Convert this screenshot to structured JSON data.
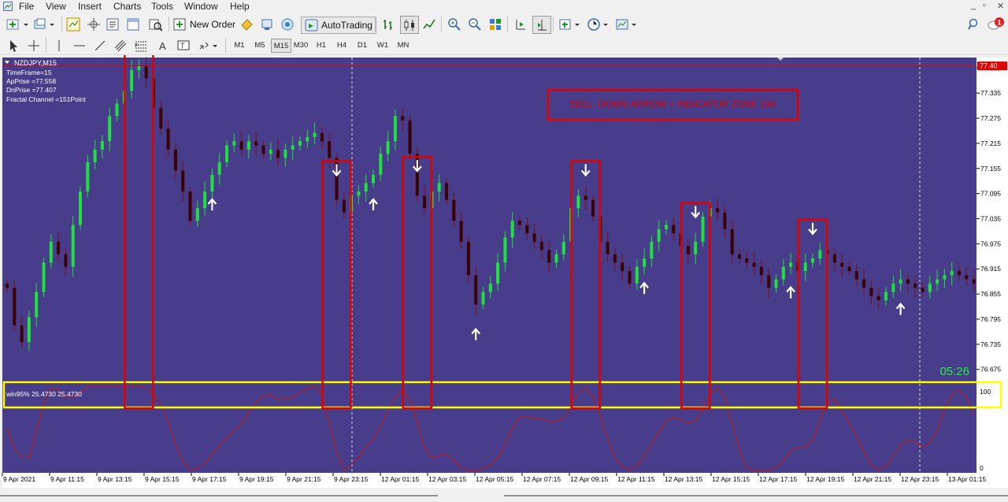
{
  "menu": {
    "items": [
      "File",
      "View",
      "Insert",
      "Charts",
      "Tools",
      "Window",
      "Help"
    ],
    "window_controls": [
      "_",
      "▫",
      "✕"
    ]
  },
  "toolbar": {
    "new_order_label": "New Order",
    "autotrading_label": "AutoTrading",
    "notification_count": "1"
  },
  "timeframes": [
    "M1",
    "M5",
    "M15",
    "M30",
    "H1",
    "H4",
    "D1",
    "W1",
    "MN"
  ],
  "active_timeframe": "M15",
  "chart": {
    "symbol": "NZDJPY,M15",
    "info_lines": [
      "TimeFrame=15",
      "ApPrise =77.558",
      "DnPrise =77.407",
      "Fractal Channel =151Point"
    ],
    "annotation": "SELL: DOWN ARROW + INDICATOR ZONE 100",
    "countdown": "05:26",
    "current_price": "77.40",
    "indicator_label": "win95% 25.4730 25.4730",
    "indicator_ticks": [
      "100",
      "0"
    ],
    "colors": {
      "background": "#483d8b",
      "bull": "#22dd44",
      "bear": "#3a0008",
      "highlight_box": "#e00000",
      "indicator_zone": "#ffff00",
      "indicator_line": "#c01818",
      "countdown": "#22ee44"
    }
  },
  "chart_data": {
    "type": "candlestick",
    "title": "NZDJPY,M15",
    "price_ticks": [
      "77.395",
      "77.335",
      "77.275",
      "77.215",
      "77.155",
      "77.095",
      "77.035",
      "76.975",
      "76.915",
      "76.855",
      "76.795",
      "76.735",
      "76.675"
    ],
    "time_ticks": [
      "9 Apr 2021",
      "9 Apr 11:15",
      "9 Apr 13:15",
      "9 Apr 15:15",
      "9 Apr 17:15",
      "9 Apr 19:15",
      "9 Apr 21:15",
      "9 Apr 23:15",
      "12 Apr 01:15",
      "12 Apr 03:15",
      "12 Apr 05:15",
      "12 Apr 07:15",
      "12 Apr 09:15",
      "12 Apr 11:15",
      "12 Apr 13:15",
      "12 Apr 15:15",
      "12 Apr 17:15",
      "12 Apr 19:15",
      "12 Apr 21:15",
      "12 Apr 23:15",
      "13 Apr 01:15"
    ],
    "ylim": [
      76.65,
      77.42
    ],
    "closes": [
      76.87,
      76.78,
      76.74,
      76.8,
      76.86,
      76.93,
      76.98,
      76.95,
      76.92,
      77.02,
      77.1,
      77.17,
      77.2,
      77.22,
      77.28,
      77.31,
      77.34,
      77.39,
      77.4,
      77.37,
      77.3,
      77.25,
      77.2,
      77.15,
      77.1,
      77.03,
      77.06,
      77.1,
      77.14,
      77.17,
      77.21,
      77.22,
      77.2,
      77.22,
      77.21,
      77.19,
      77.2,
      77.18,
      77.2,
      77.21,
      77.22,
      77.23,
      77.24,
      77.22,
      77.18,
      77.08,
      77.05,
      77.09,
      77.1,
      77.12,
      77.14,
      77.19,
      77.22,
      77.28,
      77.27,
      77.19,
      77.09,
      77.06,
      77.1,
      77.12,
      77.08,
      77.03,
      76.98,
      76.9,
      76.83,
      76.86,
      76.88,
      76.93,
      76.99,
      77.03,
      77.02,
      77.0,
      76.98,
      76.96,
      76.93,
      76.95,
      76.98,
      77.06,
      77.09,
      77.08,
      77.04,
      76.98,
      76.95,
      76.93,
      76.91,
      76.88,
      76.92,
      76.94,
      76.98,
      77.01,
      77.02,
      77.0,
      76.97,
      76.95,
      76.98,
      77.04,
      77.06,
      77.05,
      77.01,
      76.95,
      76.94,
      76.93,
      76.92,
      76.9,
      76.87,
      76.89,
      76.92,
      76.93,
      76.91,
      76.93,
      76.94,
      76.96,
      76.95,
      76.93,
      76.92,
      76.91,
      76.89,
      76.87,
      76.85,
      76.84,
      76.86,
      76.88,
      76.89,
      76.88,
      76.87,
      76.86,
      76.88,
      76.89,
      76.9,
      76.91,
      76.9,
      76.89,
      76.88
    ],
    "down_arrows_at": [
      18,
      45,
      56,
      79,
      94,
      110
    ],
    "up_arrows_at": [
      28,
      50,
      64,
      87,
      107,
      122
    ],
    "indicator": {
      "name": "win95%",
      "range": [
        0,
        100
      ],
      "zone": 100
    }
  }
}
